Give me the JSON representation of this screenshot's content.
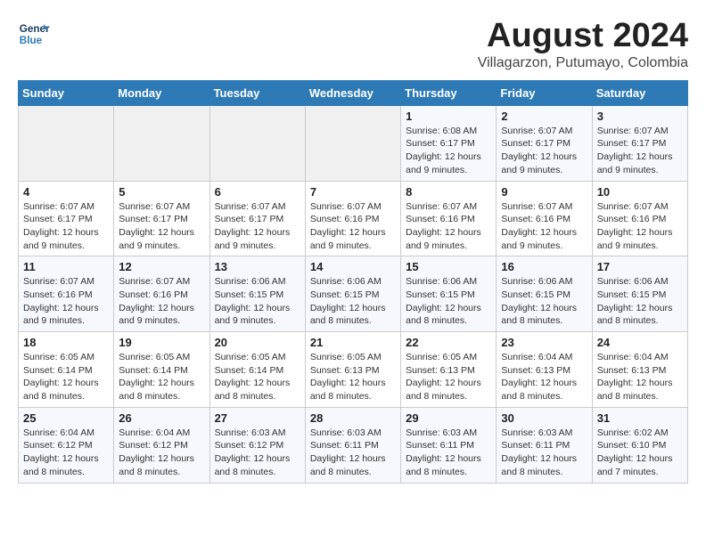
{
  "logo": {
    "line1": "General",
    "line2": "Blue"
  },
  "title": "August 2024",
  "subtitle": "Villagarzon, Putumayo, Colombia",
  "weekdays": [
    "Sunday",
    "Monday",
    "Tuesday",
    "Wednesday",
    "Thursday",
    "Friday",
    "Saturday"
  ],
  "weeks": [
    [
      {
        "day": "",
        "info": ""
      },
      {
        "day": "",
        "info": ""
      },
      {
        "day": "",
        "info": ""
      },
      {
        "day": "",
        "info": ""
      },
      {
        "day": "1",
        "info": "Sunrise: 6:08 AM\nSunset: 6:17 PM\nDaylight: 12 hours\nand 9 minutes."
      },
      {
        "day": "2",
        "info": "Sunrise: 6:07 AM\nSunset: 6:17 PM\nDaylight: 12 hours\nand 9 minutes."
      },
      {
        "day": "3",
        "info": "Sunrise: 6:07 AM\nSunset: 6:17 PM\nDaylight: 12 hours\nand 9 minutes."
      }
    ],
    [
      {
        "day": "4",
        "info": "Sunrise: 6:07 AM\nSunset: 6:17 PM\nDaylight: 12 hours\nand 9 minutes."
      },
      {
        "day": "5",
        "info": "Sunrise: 6:07 AM\nSunset: 6:17 PM\nDaylight: 12 hours\nand 9 minutes."
      },
      {
        "day": "6",
        "info": "Sunrise: 6:07 AM\nSunset: 6:17 PM\nDaylight: 12 hours\nand 9 minutes."
      },
      {
        "day": "7",
        "info": "Sunrise: 6:07 AM\nSunset: 6:16 PM\nDaylight: 12 hours\nand 9 minutes."
      },
      {
        "day": "8",
        "info": "Sunrise: 6:07 AM\nSunset: 6:16 PM\nDaylight: 12 hours\nand 9 minutes."
      },
      {
        "day": "9",
        "info": "Sunrise: 6:07 AM\nSunset: 6:16 PM\nDaylight: 12 hours\nand 9 minutes."
      },
      {
        "day": "10",
        "info": "Sunrise: 6:07 AM\nSunset: 6:16 PM\nDaylight: 12 hours\nand 9 minutes."
      }
    ],
    [
      {
        "day": "11",
        "info": "Sunrise: 6:07 AM\nSunset: 6:16 PM\nDaylight: 12 hours\nand 9 minutes."
      },
      {
        "day": "12",
        "info": "Sunrise: 6:07 AM\nSunset: 6:16 PM\nDaylight: 12 hours\nand 9 minutes."
      },
      {
        "day": "13",
        "info": "Sunrise: 6:06 AM\nSunset: 6:15 PM\nDaylight: 12 hours\nand 9 minutes."
      },
      {
        "day": "14",
        "info": "Sunrise: 6:06 AM\nSunset: 6:15 PM\nDaylight: 12 hours\nand 8 minutes."
      },
      {
        "day": "15",
        "info": "Sunrise: 6:06 AM\nSunset: 6:15 PM\nDaylight: 12 hours\nand 8 minutes."
      },
      {
        "day": "16",
        "info": "Sunrise: 6:06 AM\nSunset: 6:15 PM\nDaylight: 12 hours\nand 8 minutes."
      },
      {
        "day": "17",
        "info": "Sunrise: 6:06 AM\nSunset: 6:15 PM\nDaylight: 12 hours\nand 8 minutes."
      }
    ],
    [
      {
        "day": "18",
        "info": "Sunrise: 6:05 AM\nSunset: 6:14 PM\nDaylight: 12 hours\nand 8 minutes."
      },
      {
        "day": "19",
        "info": "Sunrise: 6:05 AM\nSunset: 6:14 PM\nDaylight: 12 hours\nand 8 minutes."
      },
      {
        "day": "20",
        "info": "Sunrise: 6:05 AM\nSunset: 6:14 PM\nDaylight: 12 hours\nand 8 minutes."
      },
      {
        "day": "21",
        "info": "Sunrise: 6:05 AM\nSunset: 6:13 PM\nDaylight: 12 hours\nand 8 minutes."
      },
      {
        "day": "22",
        "info": "Sunrise: 6:05 AM\nSunset: 6:13 PM\nDaylight: 12 hours\nand 8 minutes."
      },
      {
        "day": "23",
        "info": "Sunrise: 6:04 AM\nSunset: 6:13 PM\nDaylight: 12 hours\nand 8 minutes."
      },
      {
        "day": "24",
        "info": "Sunrise: 6:04 AM\nSunset: 6:13 PM\nDaylight: 12 hours\nand 8 minutes."
      }
    ],
    [
      {
        "day": "25",
        "info": "Sunrise: 6:04 AM\nSunset: 6:12 PM\nDaylight: 12 hours\nand 8 minutes."
      },
      {
        "day": "26",
        "info": "Sunrise: 6:04 AM\nSunset: 6:12 PM\nDaylight: 12 hours\nand 8 minutes."
      },
      {
        "day": "27",
        "info": "Sunrise: 6:03 AM\nSunset: 6:12 PM\nDaylight: 12 hours\nand 8 minutes."
      },
      {
        "day": "28",
        "info": "Sunrise: 6:03 AM\nSunset: 6:11 PM\nDaylight: 12 hours\nand 8 minutes."
      },
      {
        "day": "29",
        "info": "Sunrise: 6:03 AM\nSunset: 6:11 PM\nDaylight: 12 hours\nand 8 minutes."
      },
      {
        "day": "30",
        "info": "Sunrise: 6:03 AM\nSunset: 6:11 PM\nDaylight: 12 hours\nand 8 minutes."
      },
      {
        "day": "31",
        "info": "Sunrise: 6:02 AM\nSunset: 6:10 PM\nDaylight: 12 hours\nand 7 minutes."
      }
    ]
  ]
}
